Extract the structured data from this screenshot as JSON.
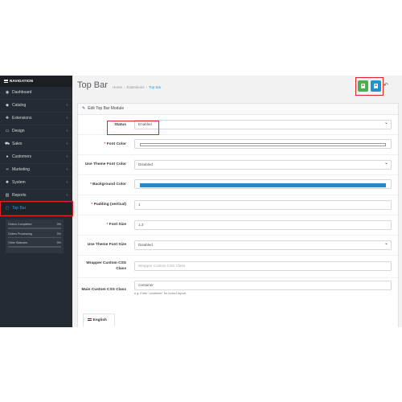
{
  "sidebar": {
    "header": "NAVIGATION",
    "items": [
      {
        "label": "Dashboard",
        "icon": "dashboard-icon",
        "glyph": "◉",
        "chevron": false
      },
      {
        "label": "Catalog",
        "icon": "tag-icon",
        "glyph": "◆",
        "chevron": true
      },
      {
        "label": "Extensions",
        "icon": "puzzle-icon",
        "glyph": "✚",
        "chevron": true
      },
      {
        "label": "Design",
        "icon": "monitor-icon",
        "glyph": "▭",
        "chevron": true
      },
      {
        "label": "Sales",
        "icon": "cart-icon",
        "glyph": "⛟",
        "chevron": true
      },
      {
        "label": "Customers",
        "icon": "user-icon",
        "glyph": "●",
        "chevron": true
      },
      {
        "label": "Marketing",
        "icon": "share-icon",
        "glyph": "⋖",
        "chevron": true
      },
      {
        "label": "System",
        "icon": "cog-icon",
        "glyph": "✹",
        "chevron": true
      },
      {
        "label": "Reports",
        "icon": "bar-chart-icon",
        "glyph": "▥",
        "chevron": true
      },
      {
        "label": "Top Bar",
        "icon": "window-icon",
        "glyph": "▢",
        "chevron": false
      }
    ],
    "stats": [
      {
        "label": "Orders Completed",
        "value": "0%",
        "fill": 0
      },
      {
        "label": "Orders Processing",
        "value": "0%",
        "fill": 0
      },
      {
        "label": "Other Statuses",
        "value": "0%",
        "fill": 0
      }
    ]
  },
  "header": {
    "title": "Top Bar",
    "breadcrumbs": [
      "Home",
      "Extensions",
      "Top Bar"
    ],
    "breadcrumb_sep": "›",
    "back_glyph": "↶"
  },
  "panel": {
    "title": "Edit Top Bar Module",
    "fields": {
      "status": {
        "label": "Status",
        "value": "Enabled"
      },
      "font_color": {
        "label": "Font Color",
        "required": "*"
      },
      "use_theme_font_color": {
        "label": "Use Theme Font Color",
        "value": "Disabled"
      },
      "background_color": {
        "label": "Background Color",
        "required": "*"
      },
      "padding_vertical": {
        "label": "Padding (vertical)",
        "required": "*",
        "value": "1"
      },
      "font_size": {
        "label": "Font Size",
        "required": "*",
        "value": "1.3"
      },
      "use_theme_font_size": {
        "label": "Use Theme Font Size",
        "value": "Disabled"
      },
      "wrapper_css": {
        "label": "Wrapper Custom CSS Class",
        "placeholder": "Wrapper Custom CSS Class"
      },
      "main_css": {
        "label": "Main Custom CSS Class",
        "value": "container",
        "hint": "e.g. Enter \"container\" for boxed layout."
      }
    },
    "tab_label": "English"
  },
  "colors": {
    "sidebar_bg": "#252b33",
    "accent_blue": "#2a9ee8",
    "save_green": "#4cae4c",
    "save_blue": "#1e91cf",
    "background_color_value": "#2f86c0",
    "highlight_red": "#e1222b"
  }
}
